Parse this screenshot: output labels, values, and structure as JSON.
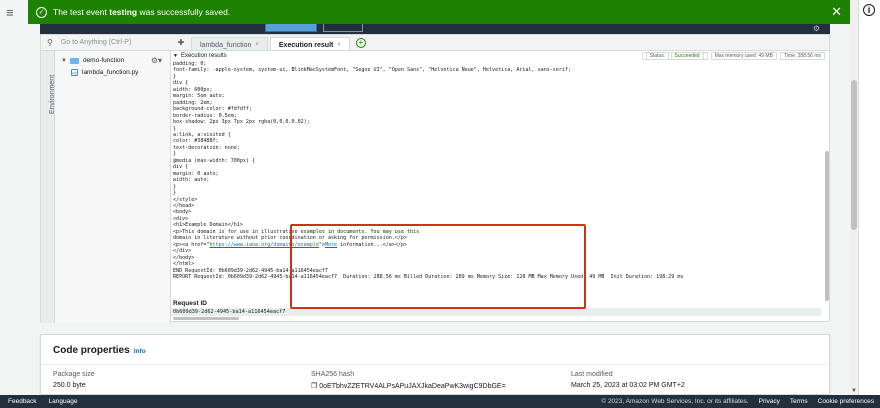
{
  "flash": {
    "pre": "The test event ",
    "event_name": "testing",
    "post": " was successfully saved."
  },
  "search": {
    "placeholder": "Go to Anything (Ctrl-P)"
  },
  "environment_label": "Environment",
  "tree": {
    "folder": "demo-function",
    "file": "lambda_function.py"
  },
  "tabs": [
    {
      "label": "lambda_function",
      "close": "×"
    },
    {
      "label": "Execution result",
      "close": "×"
    }
  ],
  "results": {
    "title": "Execution results",
    "status_label": "Status:",
    "status_value": "Succeeded",
    "memory": "Max memory used: 49 MB",
    "time": "Time: 288.56 ms"
  },
  "code_lines": [
    "padding: 0;",
    "font-family: -apple-system, system-ui, BlinkMacSystemFont, \"Segoe UI\", \"Open Sans\", \"Helvetica Neue\", Helvetica, Arial, sans-serif;",
    "}",
    "div {",
    "width: 600px;",
    "margin: 5em auto;",
    "padding: 2em;",
    "background-color: #fdfdff;",
    "border-radius: 0.5em;",
    "box-shadow: 2px 3px 7px 2px rgba(0,0,0,0.02);",
    "}",
    "a:link, a:visited {",
    "color: #38488f;",
    "text-decoration: none;",
    "}",
    "@media (max-width: 700px) {",
    "div {",
    "margin: 0 auto;",
    "width: auto;",
    "}",
    "}",
    "</style>",
    "</head>",
    "<body>",
    "<div>",
    "<h1>Example Domain</h1>",
    "<p>This domain is for use in illustrative examples in documents. You may use this",
    "domain in literature without prior coordination or asking for permission.</p>"
  ],
  "link_line": {
    "pre": "<p><a href=\"",
    "url": "https://www.iana.org/domains/example",
    "mid": "\">",
    "more": "More",
    "post": " information...</a></p>"
  },
  "code_tail": [
    "</div>",
    "</body>",
    "</html>",
    "END RequestId: 0b609d39-2d62-4945-ba14-a116454eacf7",
    "REPORT RequestId: 0b609d39-2d62-4945-ba14-a116454eacf7  Duration: 288.56 ms Billed Duration: 289 ms Memory Size: 128 MB Max Memory Used: 49 MB  Init Duration: 198.29 ms"
  ],
  "request": {
    "label": "Request ID",
    "value": "0b609d39-2d62-4945-ba14-a116454eacf7"
  },
  "code_properties": {
    "title": "Code properties",
    "info": "Info",
    "package_size_label": "Package size",
    "package_size_value": "250.0 byte",
    "sha_label": "SHA256 hash",
    "sha_value": "0oETbhvZZETRV4ALPsAPuJAXJkaDeaPwK3wigC9DbGE=",
    "modified_label": "Last modified",
    "modified_value": "March 25, 2023 at 03:02 PM GMT+2"
  },
  "footer": {
    "feedback": "Feedback",
    "language": "Language",
    "copyright": "© 2023, Amazon Web Services, Inc. or its affiliates.",
    "privacy": "Privacy",
    "terms": "Terms",
    "cookies": "Cookie preferences"
  },
  "colors": {
    "flash_green": "#1d8102",
    "highlight_red": "#d13212",
    "link_blue": "#0073bb",
    "footer_bg": "#232f3e"
  }
}
